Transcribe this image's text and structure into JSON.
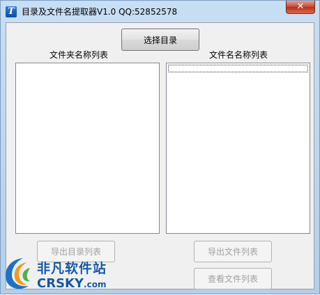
{
  "window": {
    "title": "目录及文件名提取器V1.0   QQ:52852578",
    "close_glyph": "✕"
  },
  "buttons": {
    "select_dir": "选择目录",
    "export_dir_list": "导出目录列表",
    "export_file_list": "导出文件列表",
    "view_file_list": "查看文件列表"
  },
  "labels": {
    "folder_list": "文件夹名称列表",
    "file_list": "文件名名称列表"
  },
  "watermark": {
    "cn": "非凡软件站",
    "en": "CRSKY",
    "en_suffix": ".com"
  }
}
